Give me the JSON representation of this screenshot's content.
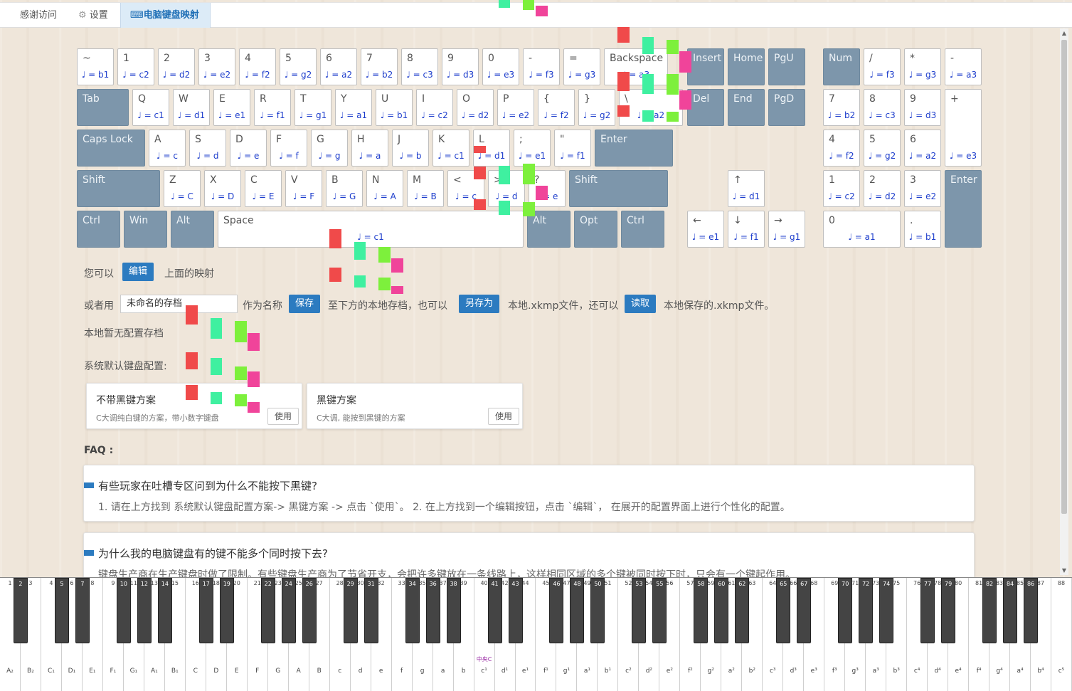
{
  "tabs": [
    {
      "label": "感谢访问"
    },
    {
      "label": "设置"
    },
    {
      "label": "电脑键盘映射"
    }
  ],
  "keyboard": {
    "rows": [
      [
        {
          "k": "~",
          "n": "♩ = b1"
        },
        {
          "k": "1",
          "n": "♩ = c2"
        },
        {
          "k": "2",
          "n": "♩ = d2"
        },
        {
          "k": "3",
          "n": "♩ = e2"
        },
        {
          "k": "4",
          "n": "♩ = f2"
        },
        {
          "k": "5",
          "n": "♩ = g2"
        },
        {
          "k": "6",
          "n": "♩ = a2"
        },
        {
          "k": "7",
          "n": "♩ = b2"
        },
        {
          "k": "8",
          "n": "♩ = c3"
        },
        {
          "k": "9",
          "n": "♩ = d3"
        },
        {
          "k": "0",
          "n": "♩ = e3"
        },
        {
          "k": "-",
          "n": "♩ = f3"
        },
        {
          "k": "=",
          "n": "♩ = g3"
        },
        {
          "k": "Backspace",
          "n": "♩ = a3"
        }
      ],
      [
        {
          "k": "Tab",
          "n": ""
        },
        {
          "k": "Q",
          "n": "♩ = c1"
        },
        {
          "k": "W",
          "n": "♩ = d1"
        },
        {
          "k": "E",
          "n": "♩ = e1"
        },
        {
          "k": "R",
          "n": "♩ = f1"
        },
        {
          "k": "T",
          "n": "♩ = g1"
        },
        {
          "k": "Y",
          "n": "♩ = a1"
        },
        {
          "k": "U",
          "n": "♩ = b1"
        },
        {
          "k": "I",
          "n": "♩ = c2"
        },
        {
          "k": "O",
          "n": "♩ = d2"
        },
        {
          "k": "P",
          "n": "♩ = e2"
        },
        {
          "k": "{",
          "n": "♩ = f2"
        },
        {
          "k": "}",
          "n": "♩ = g2"
        },
        {
          "k": "\\",
          "n": "♩ = a2"
        }
      ],
      [
        {
          "k": "Caps Lock",
          "n": ""
        },
        {
          "k": "A",
          "n": "♩ = c"
        },
        {
          "k": "S",
          "n": "♩ = d"
        },
        {
          "k": "D",
          "n": "♩ = e"
        },
        {
          "k": "F",
          "n": "♩ = f"
        },
        {
          "k": "G",
          "n": "♩ = g"
        },
        {
          "k": "H",
          "n": "♩ = a"
        },
        {
          "k": "J",
          "n": "♩ = b"
        },
        {
          "k": "K",
          "n": "♩ = c1"
        },
        {
          "k": "L",
          "n": "♩ = d1"
        },
        {
          "k": ";",
          "n": "♩ = e1"
        },
        {
          "k": "\"",
          "n": "♩ = f1"
        },
        {
          "k": "Enter",
          "n": ""
        }
      ],
      [
        {
          "k": "Shift",
          "n": ""
        },
        {
          "k": "Z",
          "n": "♩ = C"
        },
        {
          "k": "X",
          "n": "♩ = D"
        },
        {
          "k": "C",
          "n": "♩ = E"
        },
        {
          "k": "V",
          "n": "♩ = F"
        },
        {
          "k": "B",
          "n": "♩ = G"
        },
        {
          "k": "N",
          "n": "♩ = A"
        },
        {
          "k": "M",
          "n": "♩ = B"
        },
        {
          "k": "<",
          "n": "♩ = c"
        },
        {
          "k": ">",
          "n": "♩ = d"
        },
        {
          "k": "?",
          "n": "♩ = e"
        },
        {
          "k": "Shift",
          "n": ""
        }
      ],
      [
        {
          "k": "Ctrl",
          "n": ""
        },
        {
          "k": "Win",
          "n": ""
        },
        {
          "k": "Alt",
          "n": ""
        },
        {
          "k": "Space",
          "n": "♩ = c1"
        },
        {
          "k": "Alt",
          "n": ""
        },
        {
          "k": "Opt",
          "n": ""
        },
        {
          "k": "Ctrl",
          "n": ""
        }
      ]
    ],
    "nav": [
      {
        "k": "Insert",
        "n": ""
      },
      {
        "k": "Home",
        "n": ""
      },
      {
        "k": "PgU",
        "n": ""
      },
      {
        "k": "Del",
        "n": ""
      },
      {
        "k": "End",
        "n": ""
      },
      {
        "k": "PgD",
        "n": ""
      }
    ],
    "arrows": [
      {
        "k": "↑",
        "n": "♩ = d1"
      },
      {
        "k": "←",
        "n": "♩ = e1"
      },
      {
        "k": "↓",
        "n": "♩ = f1"
      },
      {
        "k": "→",
        "n": "♩ = g1"
      }
    ],
    "numpad": [
      {
        "k": "Num",
        "n": ""
      },
      {
        "k": "/",
        "n": "♩ = f3"
      },
      {
        "k": "*",
        "n": "♩ = g3"
      },
      {
        "k": "-",
        "n": "♩ = a3"
      },
      {
        "k": "7",
        "n": "♩ = b2"
      },
      {
        "k": "8",
        "n": "♩ = c3"
      },
      {
        "k": "9",
        "n": "♩ = d3"
      },
      {
        "k": "+",
        "n": "♩ = e3"
      },
      {
        "k": "4",
        "n": "♩ = f2"
      },
      {
        "k": "5",
        "n": "♩ = g2"
      },
      {
        "k": "6",
        "n": "♩ = a2"
      },
      {
        "k": "1",
        "n": "♩ = c2"
      },
      {
        "k": "2",
        "n": "♩ = d2"
      },
      {
        "k": "3",
        "n": "♩ = e2"
      },
      {
        "k": "Enter",
        "n": ""
      },
      {
        "k": "0",
        "n": "♩ = a1"
      },
      {
        "k": ".",
        "n": "♩ = b1"
      }
    ]
  },
  "edit_line": {
    "prefix": "您可以",
    "button": "编辑",
    "suffix": "上面的映射"
  },
  "save_line": {
    "prefix": "或者用",
    "input_value": "未命名的存档",
    "t1": "作为名称",
    "save": "保存",
    "t2": "至下方的本地存档，也可以",
    "save_as": "另存为",
    "t3": "本地.xkmp文件，还可以",
    "read": "读取",
    "t4": "本地保存的.xkmp文件。"
  },
  "no_local": "本地暂无配置存档",
  "defaults_label": "系统默认键盘配置:",
  "presets": [
    {
      "title": "不带黑键方案",
      "desc": "C大调纯白键的方案，带小数字键盘",
      "button": "使用"
    },
    {
      "title": "黑键方案",
      "desc": "C大调, 能按到黑键的方案",
      "button": "使用"
    }
  ],
  "faq_title": "FAQ :",
  "faq": [
    {
      "q": "有些玩家在吐槽专区问到为什么不能按下黑键?",
      "a": "1. 请在上方找到 系统默认键盘配置方案-> 黑键方案 -> 点击 `使用`。 2. 在上方找到一个编辑按钮，点击 `编辑`， 在展开的配置界面上进行个性化的配置。"
    },
    {
      "q": "为什么我的电脑键盘有的键不能多个同时按下去?",
      "a": "键盘生产商在生产键盘时做了限制。有些键盘生产商为了节省开支，会把许多键放在一条线路上，这样相同区域的多个键被同时按下时，只会有一个键起作用。"
    }
  ],
  "piano": {
    "middle_c_label": "中央C",
    "white_labels": [
      "A₂",
      "B₂",
      "C₁",
      "D₁",
      "E₁",
      "F₁",
      "G₁",
      "A₁",
      "B₁",
      "C",
      "D",
      "E",
      "F",
      "G",
      "A",
      "B",
      "c",
      "d",
      "e",
      "f",
      "g",
      "a",
      "b",
      "c¹",
      "d¹",
      "e¹",
      "f¹",
      "g¹",
      "a¹",
      "b¹",
      "c²",
      "d²",
      "e²",
      "f²",
      "g²",
      "a²",
      "b²",
      "c³",
      "d³",
      "e³",
      "f³",
      "g³",
      "a³",
      "b³",
      "c⁴",
      "d⁴",
      "e⁴",
      "f⁴",
      "g⁴",
      "a⁴",
      "b⁴",
      "c⁵"
    ],
    "white_numbers": [
      "1",
      "3",
      "4",
      "6",
      "8",
      "9",
      "11",
      "13",
      "15",
      "16",
      "18",
      "20",
      "21",
      "23",
      "25",
      "27",
      "28",
      "30",
      "32",
      "33",
      "35",
      "37",
      "39",
      "40",
      "42",
      "44",
      "45",
      "47",
      "49",
      "51",
      "52",
      "54",
      "56",
      "57",
      "59",
      "61",
      "63",
      "64",
      "66",
      "68",
      "69",
      "71",
      "73",
      "75",
      "76",
      "78",
      "80",
      "81",
      "83",
      "85",
      "87",
      "88"
    ],
    "black_numbers": [
      "2",
      "5",
      "7",
      "10",
      "12",
      "14",
      "17",
      "19",
      "22",
      "24",
      "26",
      "29",
      "31",
      "34",
      "36",
      "38",
      "41",
      "43",
      "46",
      "48",
      "50",
      "53",
      "55",
      "58",
      "60",
      "62",
      "65",
      "67",
      "70",
      "72",
      "74",
      "77",
      "79",
      "82",
      "84",
      "86"
    ]
  },
  "colors": {
    "accent": "#2c7bc0",
    "key_dark": "#7d96ab",
    "note": "#1d3dcc",
    "red": "#f04a4a",
    "green": "#3ff0a0",
    "lime": "#7df03c",
    "pink": "#f0449a"
  }
}
